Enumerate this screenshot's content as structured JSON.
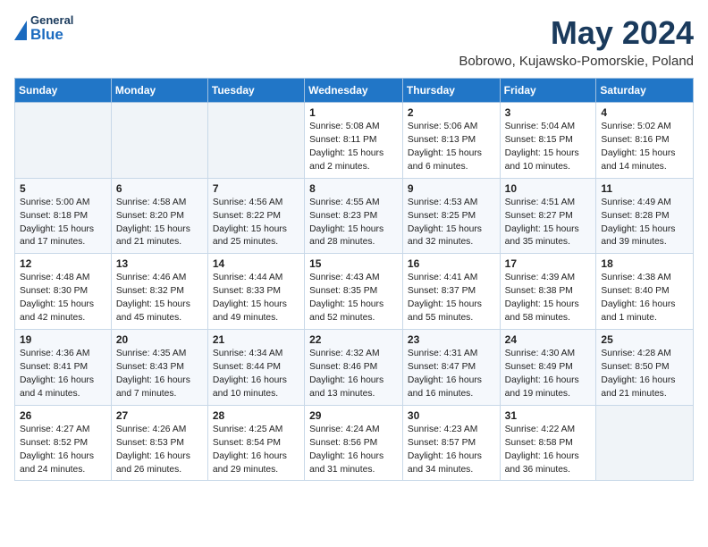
{
  "header": {
    "logo": {
      "general": "General",
      "blue": "Blue"
    },
    "title": "May 2024",
    "location": "Bobrowo, Kujawsko-Pomorskie, Poland"
  },
  "days_of_week": [
    "Sunday",
    "Monday",
    "Tuesday",
    "Wednesday",
    "Thursday",
    "Friday",
    "Saturday"
  ],
  "weeks": [
    [
      {
        "day": "",
        "info": ""
      },
      {
        "day": "",
        "info": ""
      },
      {
        "day": "",
        "info": ""
      },
      {
        "day": "1",
        "info": "Sunrise: 5:08 AM\nSunset: 8:11 PM\nDaylight: 15 hours\nand 2 minutes."
      },
      {
        "day": "2",
        "info": "Sunrise: 5:06 AM\nSunset: 8:13 PM\nDaylight: 15 hours\nand 6 minutes."
      },
      {
        "day": "3",
        "info": "Sunrise: 5:04 AM\nSunset: 8:15 PM\nDaylight: 15 hours\nand 10 minutes."
      },
      {
        "day": "4",
        "info": "Sunrise: 5:02 AM\nSunset: 8:16 PM\nDaylight: 15 hours\nand 14 minutes."
      }
    ],
    [
      {
        "day": "5",
        "info": "Sunrise: 5:00 AM\nSunset: 8:18 PM\nDaylight: 15 hours\nand 17 minutes."
      },
      {
        "day": "6",
        "info": "Sunrise: 4:58 AM\nSunset: 8:20 PM\nDaylight: 15 hours\nand 21 minutes."
      },
      {
        "day": "7",
        "info": "Sunrise: 4:56 AM\nSunset: 8:22 PM\nDaylight: 15 hours\nand 25 minutes."
      },
      {
        "day": "8",
        "info": "Sunrise: 4:55 AM\nSunset: 8:23 PM\nDaylight: 15 hours\nand 28 minutes."
      },
      {
        "day": "9",
        "info": "Sunrise: 4:53 AM\nSunset: 8:25 PM\nDaylight: 15 hours\nand 32 minutes."
      },
      {
        "day": "10",
        "info": "Sunrise: 4:51 AM\nSunset: 8:27 PM\nDaylight: 15 hours\nand 35 minutes."
      },
      {
        "day": "11",
        "info": "Sunrise: 4:49 AM\nSunset: 8:28 PM\nDaylight: 15 hours\nand 39 minutes."
      }
    ],
    [
      {
        "day": "12",
        "info": "Sunrise: 4:48 AM\nSunset: 8:30 PM\nDaylight: 15 hours\nand 42 minutes."
      },
      {
        "day": "13",
        "info": "Sunrise: 4:46 AM\nSunset: 8:32 PM\nDaylight: 15 hours\nand 45 minutes."
      },
      {
        "day": "14",
        "info": "Sunrise: 4:44 AM\nSunset: 8:33 PM\nDaylight: 15 hours\nand 49 minutes."
      },
      {
        "day": "15",
        "info": "Sunrise: 4:43 AM\nSunset: 8:35 PM\nDaylight: 15 hours\nand 52 minutes."
      },
      {
        "day": "16",
        "info": "Sunrise: 4:41 AM\nSunset: 8:37 PM\nDaylight: 15 hours\nand 55 minutes."
      },
      {
        "day": "17",
        "info": "Sunrise: 4:39 AM\nSunset: 8:38 PM\nDaylight: 15 hours\nand 58 minutes."
      },
      {
        "day": "18",
        "info": "Sunrise: 4:38 AM\nSunset: 8:40 PM\nDaylight: 16 hours\nand 1 minute."
      }
    ],
    [
      {
        "day": "19",
        "info": "Sunrise: 4:36 AM\nSunset: 8:41 PM\nDaylight: 16 hours\nand 4 minutes."
      },
      {
        "day": "20",
        "info": "Sunrise: 4:35 AM\nSunset: 8:43 PM\nDaylight: 16 hours\nand 7 minutes."
      },
      {
        "day": "21",
        "info": "Sunrise: 4:34 AM\nSunset: 8:44 PM\nDaylight: 16 hours\nand 10 minutes."
      },
      {
        "day": "22",
        "info": "Sunrise: 4:32 AM\nSunset: 8:46 PM\nDaylight: 16 hours\nand 13 minutes."
      },
      {
        "day": "23",
        "info": "Sunrise: 4:31 AM\nSunset: 8:47 PM\nDaylight: 16 hours\nand 16 minutes."
      },
      {
        "day": "24",
        "info": "Sunrise: 4:30 AM\nSunset: 8:49 PM\nDaylight: 16 hours\nand 19 minutes."
      },
      {
        "day": "25",
        "info": "Sunrise: 4:28 AM\nSunset: 8:50 PM\nDaylight: 16 hours\nand 21 minutes."
      }
    ],
    [
      {
        "day": "26",
        "info": "Sunrise: 4:27 AM\nSunset: 8:52 PM\nDaylight: 16 hours\nand 24 minutes."
      },
      {
        "day": "27",
        "info": "Sunrise: 4:26 AM\nSunset: 8:53 PM\nDaylight: 16 hours\nand 26 minutes."
      },
      {
        "day": "28",
        "info": "Sunrise: 4:25 AM\nSunset: 8:54 PM\nDaylight: 16 hours\nand 29 minutes."
      },
      {
        "day": "29",
        "info": "Sunrise: 4:24 AM\nSunset: 8:56 PM\nDaylight: 16 hours\nand 31 minutes."
      },
      {
        "day": "30",
        "info": "Sunrise: 4:23 AM\nSunset: 8:57 PM\nDaylight: 16 hours\nand 34 minutes."
      },
      {
        "day": "31",
        "info": "Sunrise: 4:22 AM\nSunset: 8:58 PM\nDaylight: 16 hours\nand 36 minutes."
      },
      {
        "day": "",
        "info": ""
      }
    ]
  ]
}
